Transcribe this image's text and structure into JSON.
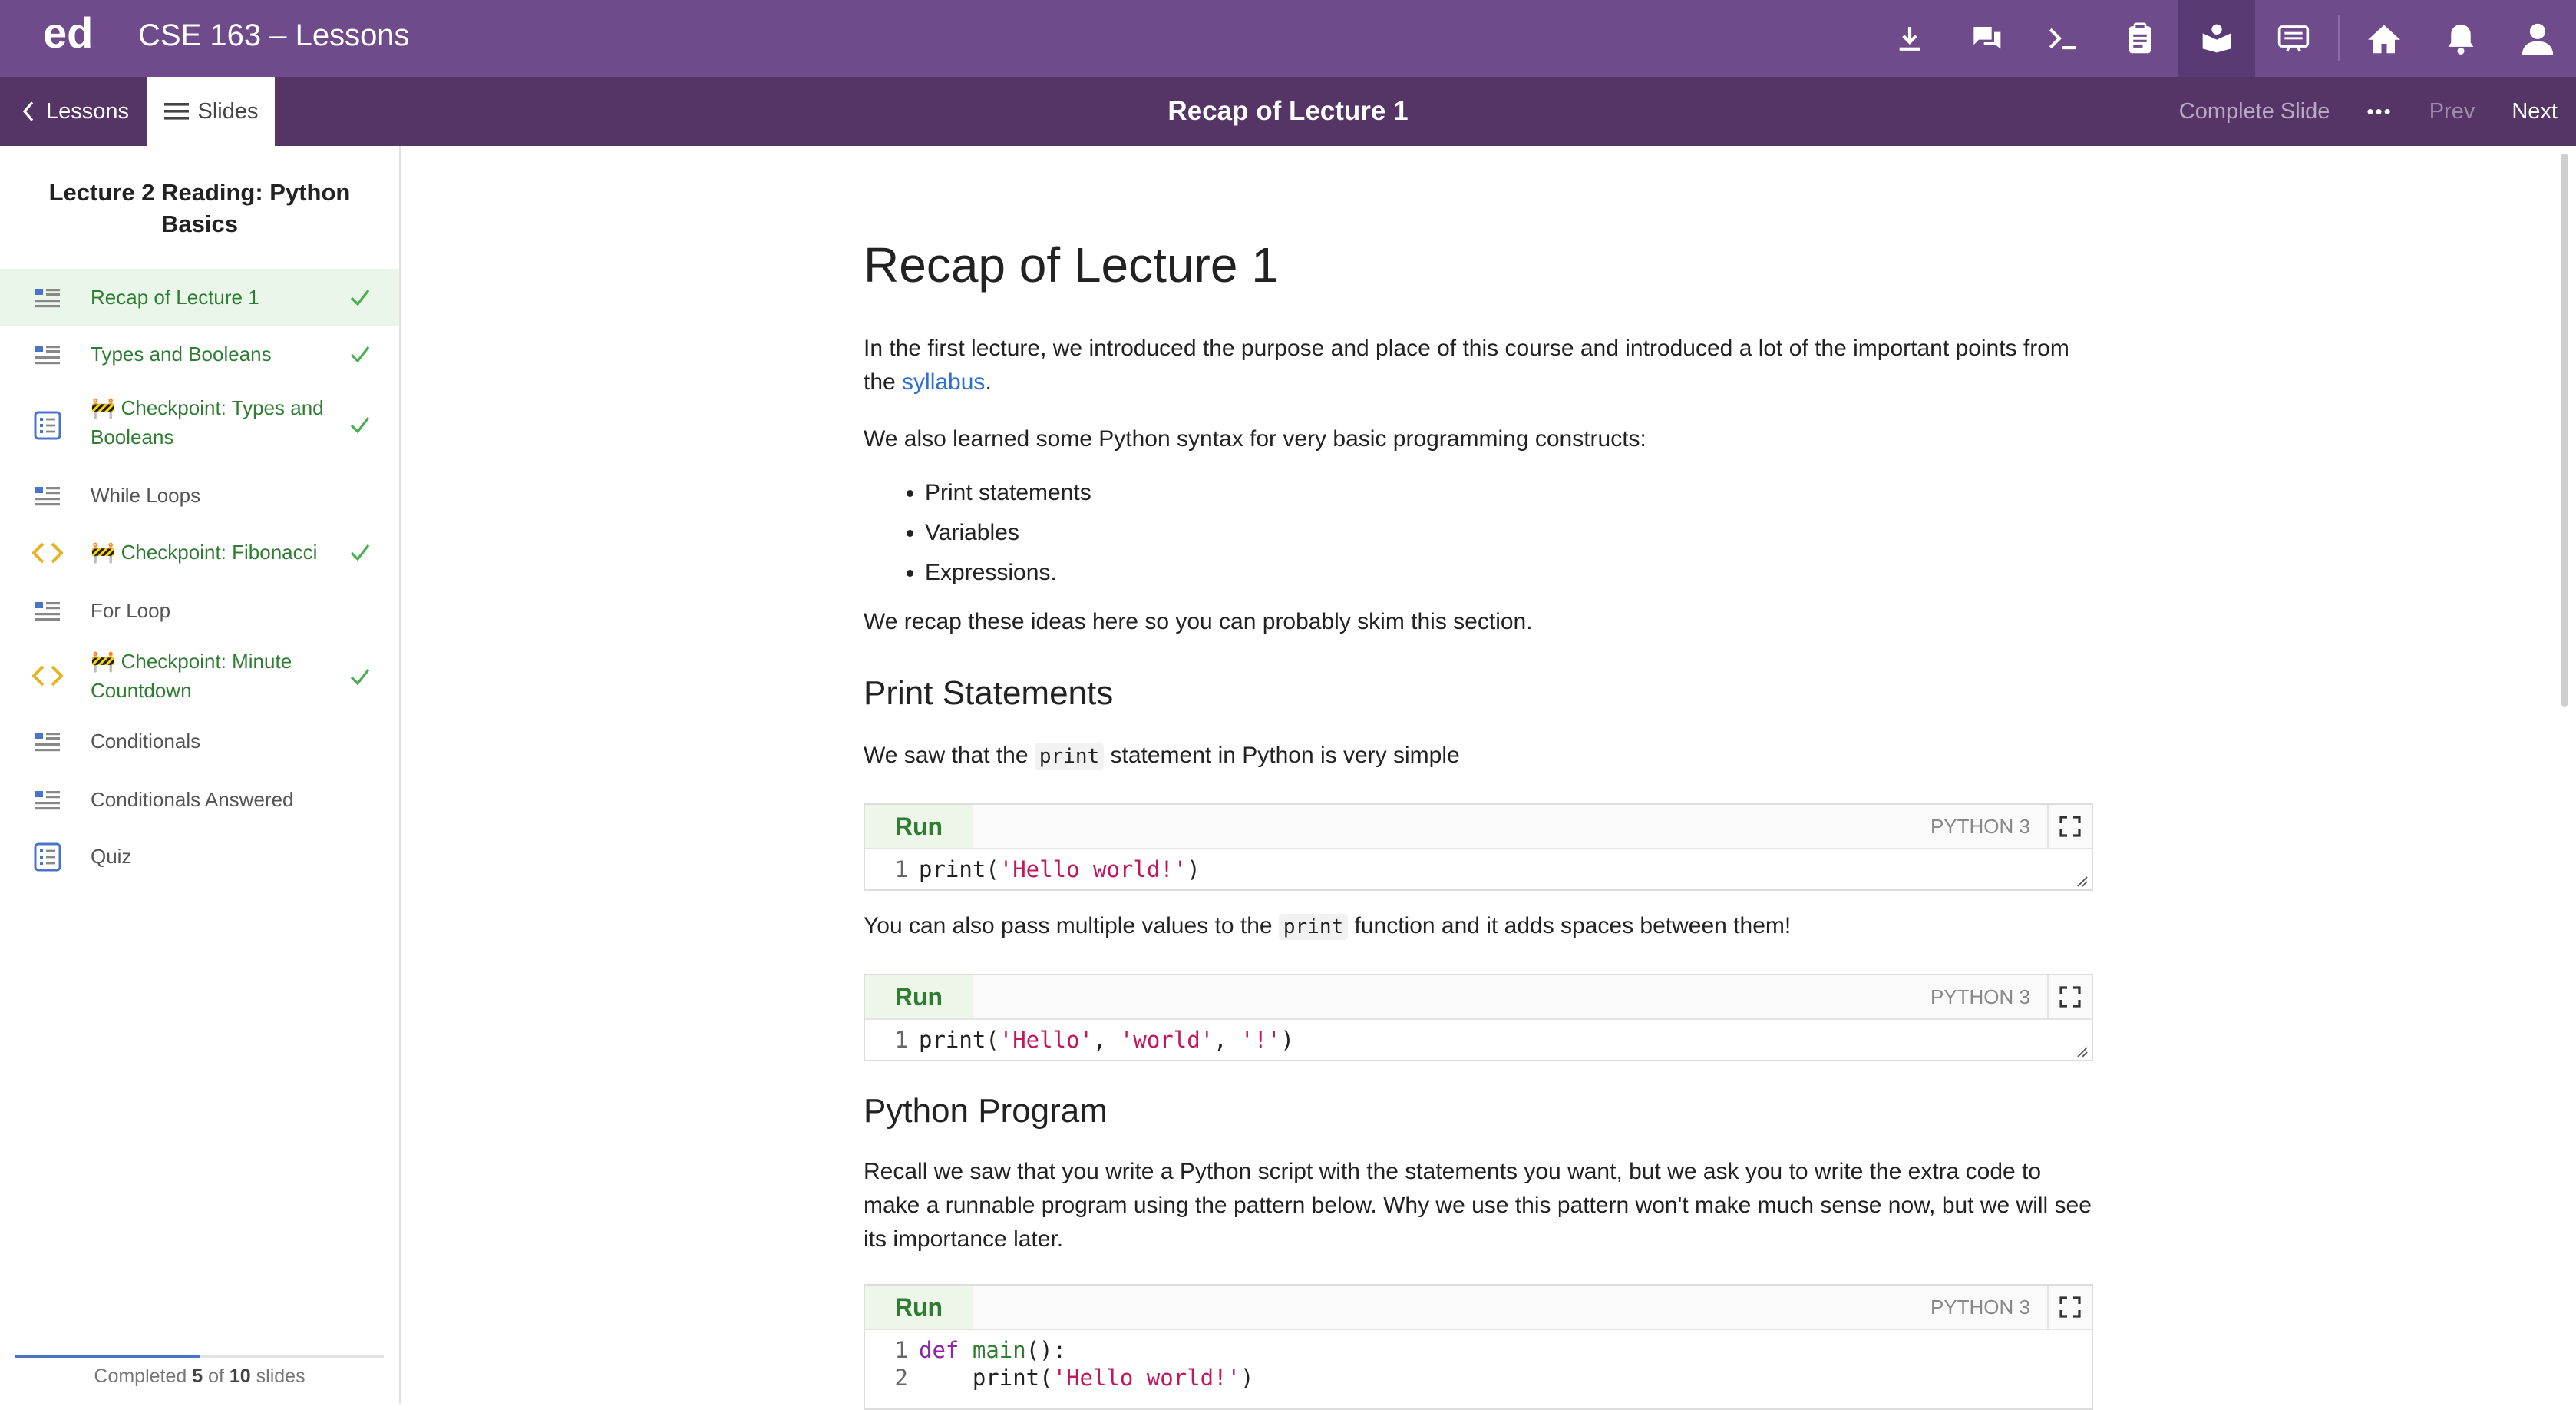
{
  "app": {
    "logo": "ed",
    "course_title": "CSE 163 – Lessons"
  },
  "topbar": {
    "icons": [
      "download-icon",
      "chat-icon",
      "terminal-icon",
      "clipboard-icon",
      "lessons-icon",
      "slides-icon",
      "home-icon",
      "bell-icon",
      "user-icon"
    ]
  },
  "subbar": {
    "back_label": "Lessons",
    "slides_label": "Slides",
    "slide_title": "Recap of Lecture 1",
    "complete_label": "Complete Slide",
    "more_label": "•••",
    "prev_label": "Prev",
    "next_label": "Next"
  },
  "sidebar": {
    "heading": "Lecture 2 Reading: Python Basics",
    "items": [
      {
        "label": "Recap of Lecture 1",
        "type": "doc",
        "done": true,
        "active": true
      },
      {
        "label": "Types and Booleans",
        "type": "doc",
        "done": true
      },
      {
        "label": "🚧 Checkpoint: Types and Booleans",
        "type": "quiz",
        "done": true
      },
      {
        "label": "While Loops",
        "type": "doc",
        "done": false
      },
      {
        "label": "🚧 Checkpoint: Fibonacci",
        "type": "code",
        "done": true
      },
      {
        "label": "For Loop",
        "type": "doc",
        "done": false
      },
      {
        "label": "🚧 Checkpoint: Minute Countdown",
        "type": "code",
        "done": true
      },
      {
        "label": "Conditionals",
        "type": "doc",
        "done": false
      },
      {
        "label": "Conditionals Answered",
        "type": "doc",
        "done": false
      },
      {
        "label": "Quiz",
        "type": "quiz",
        "done": false
      }
    ],
    "progress": {
      "prefix": "Completed ",
      "done": "5",
      "middle": " of ",
      "total": "10",
      "suffix": " slides",
      "fraction": 0.5
    }
  },
  "content": {
    "title": "Recap of Lecture 1",
    "p1_a": "In the first lecture, we introduced the purpose and place of this course and introduced a lot of the important points from the ",
    "p1_link": "syllabus",
    "p1_b": ".",
    "p2": "We also learned some Python syntax for very basic programming constructs:",
    "bullets": [
      "Print statements",
      "Variables",
      "Expressions."
    ],
    "p3": "We recap these ideas here so you can probably skim this section.",
    "h_print": "Print Statements",
    "p4_a": "We saw that the ",
    "p4_code": "print",
    "p4_b": " statement in Python is very simple",
    "p5_a": "You can also pass multiple values to the ",
    "p5_code": "print",
    "p5_b": " function and it adds spaces between them!",
    "h_program": "Python Program",
    "p6": "Recall we saw that you write a Python script with the statements you want, but we ask you to write the extra code to make a runnable program using the pattern below. Why we use this pattern won't make much sense now, but we will see its importance later.",
    "run_label": "Run",
    "lang_label": "PYTHON 3",
    "code1": {
      "ln": "1",
      "fn": "print(",
      "str": "'Hello world!'",
      "end": ")"
    },
    "code2": {
      "ln": "1",
      "fn": "print(",
      "s1": "'Hello'",
      "c1": ", ",
      "s2": "'world'",
      "c2": ", ",
      "s3": "'!'",
      "end": ")"
    },
    "code3": {
      "ln1": "1",
      "kw": "def",
      "name": "main",
      "rest1": "():",
      "ln2": "2",
      "indent": "    print(",
      "str": "'Hello world!'",
      "end": ")"
    }
  }
}
